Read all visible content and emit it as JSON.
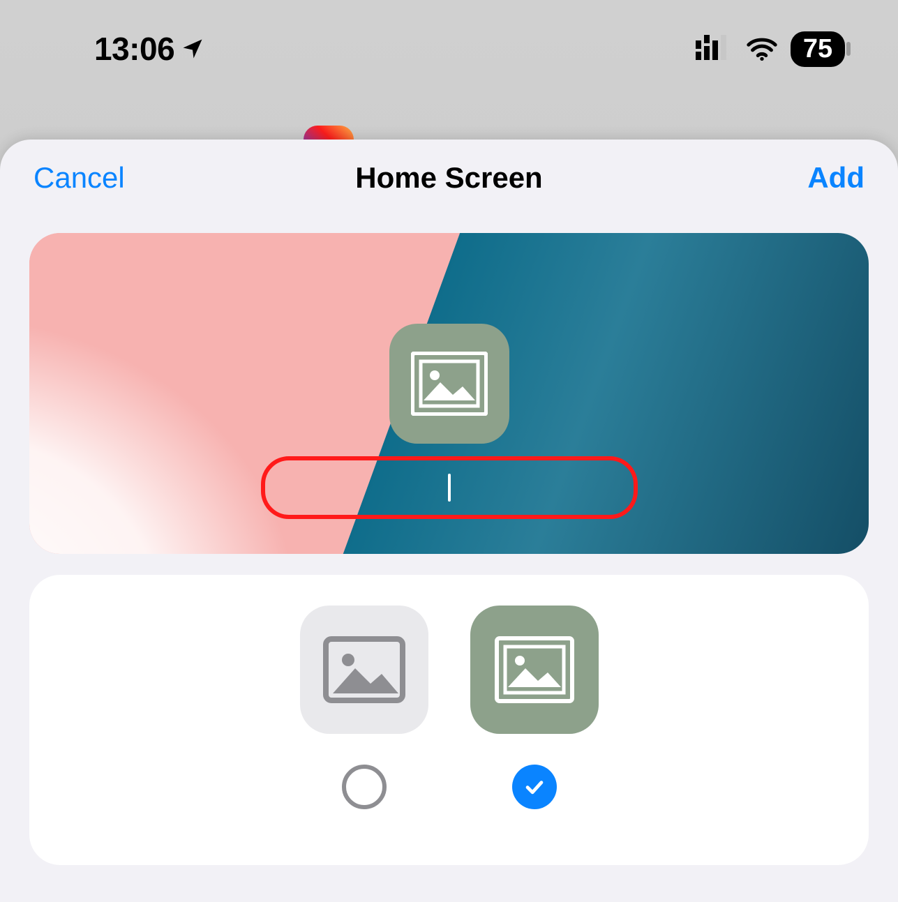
{
  "status": {
    "time": "13:06",
    "battery_percent": "75"
  },
  "sheet": {
    "cancel": "Cancel",
    "title": "Home Screen",
    "add": "Add"
  },
  "name_field": {
    "value": ""
  },
  "options": {
    "selected_index": 1
  },
  "colors": {
    "accent": "#0a84ff",
    "icon_bg_gray": "#e9e9ec",
    "icon_bg_green": "#8da18b",
    "highlight_border": "#ff1a1a"
  }
}
